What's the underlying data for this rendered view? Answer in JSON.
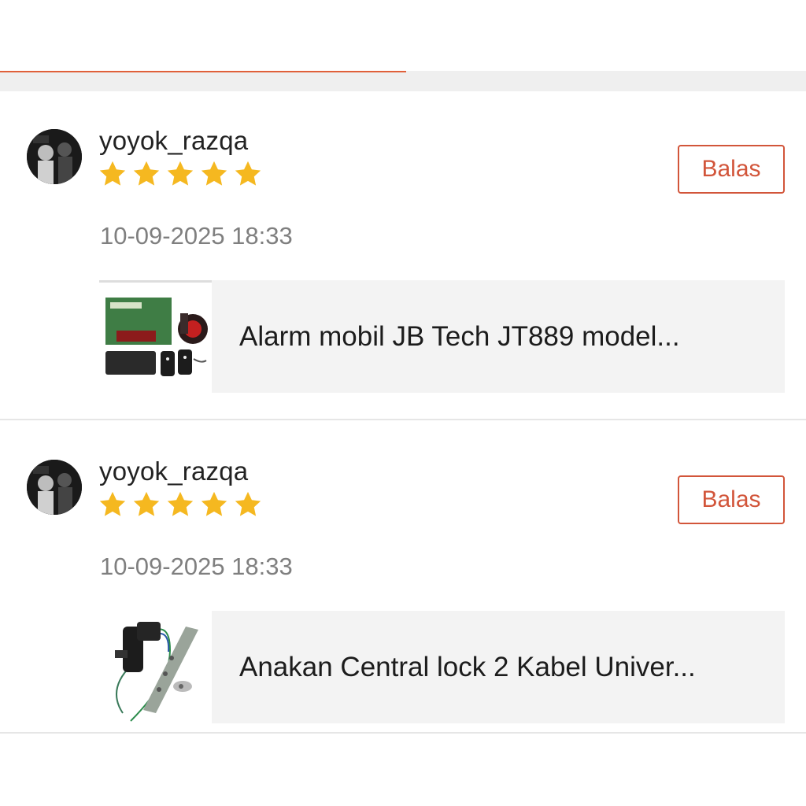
{
  "tabs": {
    "active_color": "#e0603a"
  },
  "colors": {
    "accent": "#d2553a",
    "star": "#f5b820",
    "date": "#7f7f7f"
  },
  "reviews": [
    {
      "username": "yoyok_razqa",
      "rating": 5,
      "date": "10-09-2025 18:33",
      "reply_label": "Balas",
      "product": {
        "name": "Alarm mobil JB Tech JT889 model..."
      }
    },
    {
      "username": "yoyok_razqa",
      "rating": 5,
      "date": "10-09-2025 18:33",
      "reply_label": "Balas",
      "product": {
        "name": "Anakan Central lock 2 Kabel Univer..."
      }
    }
  ]
}
